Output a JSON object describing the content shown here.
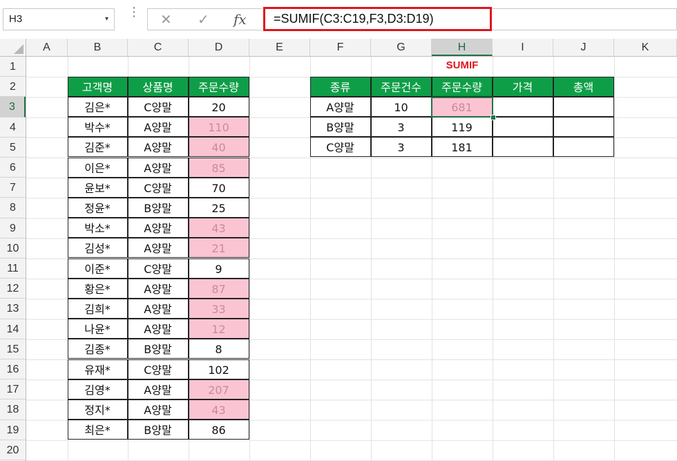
{
  "namebox": {
    "value": "H3",
    "dropdown_icon": "▾"
  },
  "formula_bar": {
    "cancel_icon": "✕",
    "enter_icon": "✓",
    "fx_icon": "fx",
    "formula": "=SUMIF(C3:C19,F3,D3:D19)"
  },
  "columns": [
    "A",
    "B",
    "C",
    "D",
    "E",
    "F",
    "G",
    "H",
    "I",
    "J",
    "K"
  ],
  "selected_column": "H",
  "rows": [
    "1",
    "2",
    "3",
    "4",
    "5",
    "6",
    "7",
    "8",
    "9",
    "10",
    "11",
    "12",
    "13",
    "14",
    "15",
    "16",
    "17",
    "18",
    "19",
    "20"
  ],
  "selected_row": "3",
  "left_table": {
    "headers": [
      "고객명",
      "상품명",
      "주문수량"
    ],
    "rows": [
      {
        "name": "김은*",
        "product": "C양말",
        "qty": "20"
      },
      {
        "name": "박수*",
        "product": "A양말",
        "qty": "110"
      },
      {
        "name": "김준*",
        "product": "A양말",
        "qty": "40"
      },
      {
        "name": "이은*",
        "product": "A양말",
        "qty": "85"
      },
      {
        "name": "윤보*",
        "product": "C양말",
        "qty": "70"
      },
      {
        "name": "정윤*",
        "product": "B양말",
        "qty": "25"
      },
      {
        "name": "박소*",
        "product": "A양말",
        "qty": "43"
      },
      {
        "name": "김성*",
        "product": "A양말",
        "qty": "21"
      },
      {
        "name": "이준*",
        "product": "C양말",
        "qty": "9"
      },
      {
        "name": "황은*",
        "product": "A양말",
        "qty": "87"
      },
      {
        "name": "김희*",
        "product": "A양말",
        "qty": "33"
      },
      {
        "name": "나윤*",
        "product": "A양말",
        "qty": "12"
      },
      {
        "name": "김종*",
        "product": "B양말",
        "qty": "8"
      },
      {
        "name": "유재*",
        "product": "C양말",
        "qty": "102"
      },
      {
        "name": "김영*",
        "product": "A양말",
        "qty": "207"
      },
      {
        "name": "정지*",
        "product": "A양말",
        "qty": "43"
      },
      {
        "name": "최은*",
        "product": "B양말",
        "qty": "86"
      }
    ]
  },
  "right_table": {
    "title": "SUMIF",
    "headers": [
      "종류",
      "주문건수",
      "주문수량",
      "가격",
      "총액"
    ],
    "rows": [
      {
        "type": "A양말",
        "count": "10",
        "qty": "681",
        "price": "",
        "total": ""
      },
      {
        "type": "B양말",
        "count": "3",
        "qty": "119",
        "price": "",
        "total": ""
      },
      {
        "type": "C양말",
        "count": "3",
        "qty": "181",
        "price": "",
        "total": ""
      }
    ]
  },
  "colors": {
    "header_green": "#0f9e48",
    "highlight_pink": "#fbc4d3",
    "formula_border": "#e0141e",
    "select_green": "#217346"
  }
}
